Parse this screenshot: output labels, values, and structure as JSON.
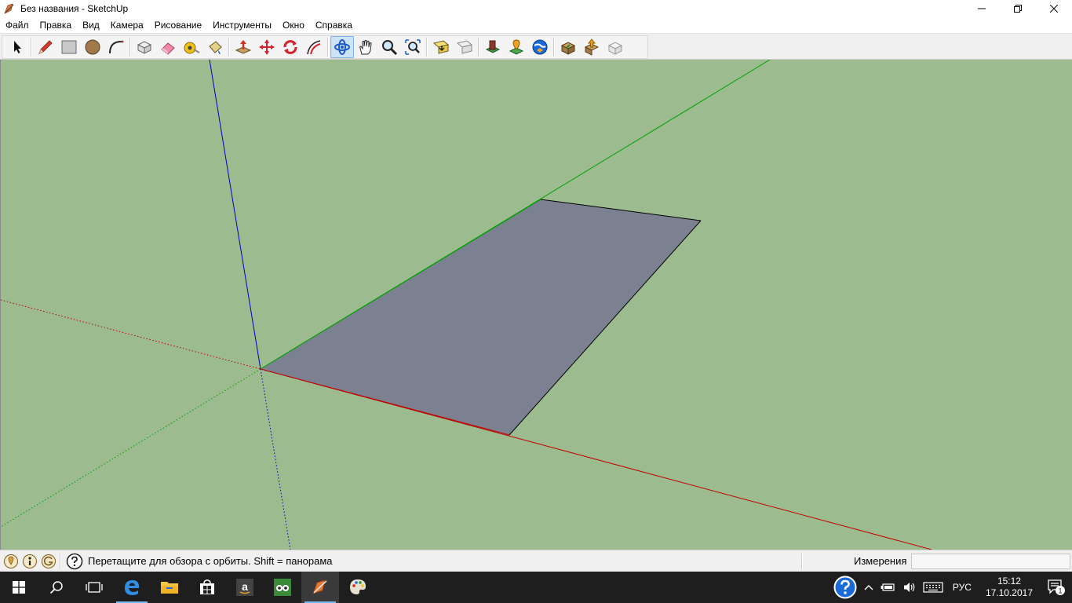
{
  "window": {
    "title": "Без названия - SketchUp",
    "minimize_glyph": "—",
    "restore_glyph": "❐",
    "close_glyph": "✕"
  },
  "menu": {
    "items": [
      "Файл",
      "Правка",
      "Вид",
      "Камера",
      "Рисование",
      "Инструменты",
      "Окно",
      "Справка"
    ]
  },
  "toolbar": {
    "tools": [
      {
        "name": "select-tool-icon"
      },
      {
        "name": "pencil-line-tool-icon"
      },
      {
        "name": "rectangle-tool-icon"
      },
      {
        "name": "circle-tool-icon"
      },
      {
        "name": "arc-tool-icon"
      },
      {
        "name": "make-component-tool-icon"
      },
      {
        "name": "eraser-tool-icon"
      },
      {
        "name": "tape-measure-tool-icon"
      },
      {
        "name": "paint-bucket-tool-icon"
      },
      {
        "name": "push-pull-tool-icon"
      },
      {
        "name": "move-tool-icon"
      },
      {
        "name": "rotate-tool-icon"
      },
      {
        "name": "offset-tool-icon"
      },
      {
        "name": "orbit-tool-icon",
        "active": true
      },
      {
        "name": "pan-tool-icon"
      },
      {
        "name": "zoom-tool-icon"
      },
      {
        "name": "zoom-extents-tool-icon"
      },
      {
        "name": "previous-view-icon"
      },
      {
        "name": "next-view-icon"
      },
      {
        "name": "get-models-icon"
      },
      {
        "name": "add-location-icon"
      },
      {
        "name": "google-earth-icon"
      },
      {
        "name": "share-model-icon"
      },
      {
        "name": "share-component-icon"
      },
      {
        "name": "extension-warehouse-icon"
      }
    ]
  },
  "viewport": {
    "background_color": "#9cbc90",
    "face_color": "#7b8191",
    "axis_red": "#c00000",
    "axis_green": "#00a000",
    "axis_blue": "#0000c0"
  },
  "statusbar": {
    "hint": "Перетащите для обзора с орбиты.  Shift = панорама",
    "measure_label": "Измерения",
    "measure_value": ""
  },
  "taskbar": {
    "apps": [
      {
        "name": "start-button"
      },
      {
        "name": "search-button"
      },
      {
        "name": "task-view-button"
      },
      {
        "name": "edge-browser-button"
      },
      {
        "name": "file-explorer-button"
      },
      {
        "name": "store-button"
      },
      {
        "name": "amazon-button"
      },
      {
        "name": "tripadvisor-button"
      },
      {
        "name": "sketchup-button"
      },
      {
        "name": "paint-button"
      }
    ],
    "language": "РУС",
    "time": "15:12",
    "date": "17.10.2017",
    "notification_count": "1"
  }
}
